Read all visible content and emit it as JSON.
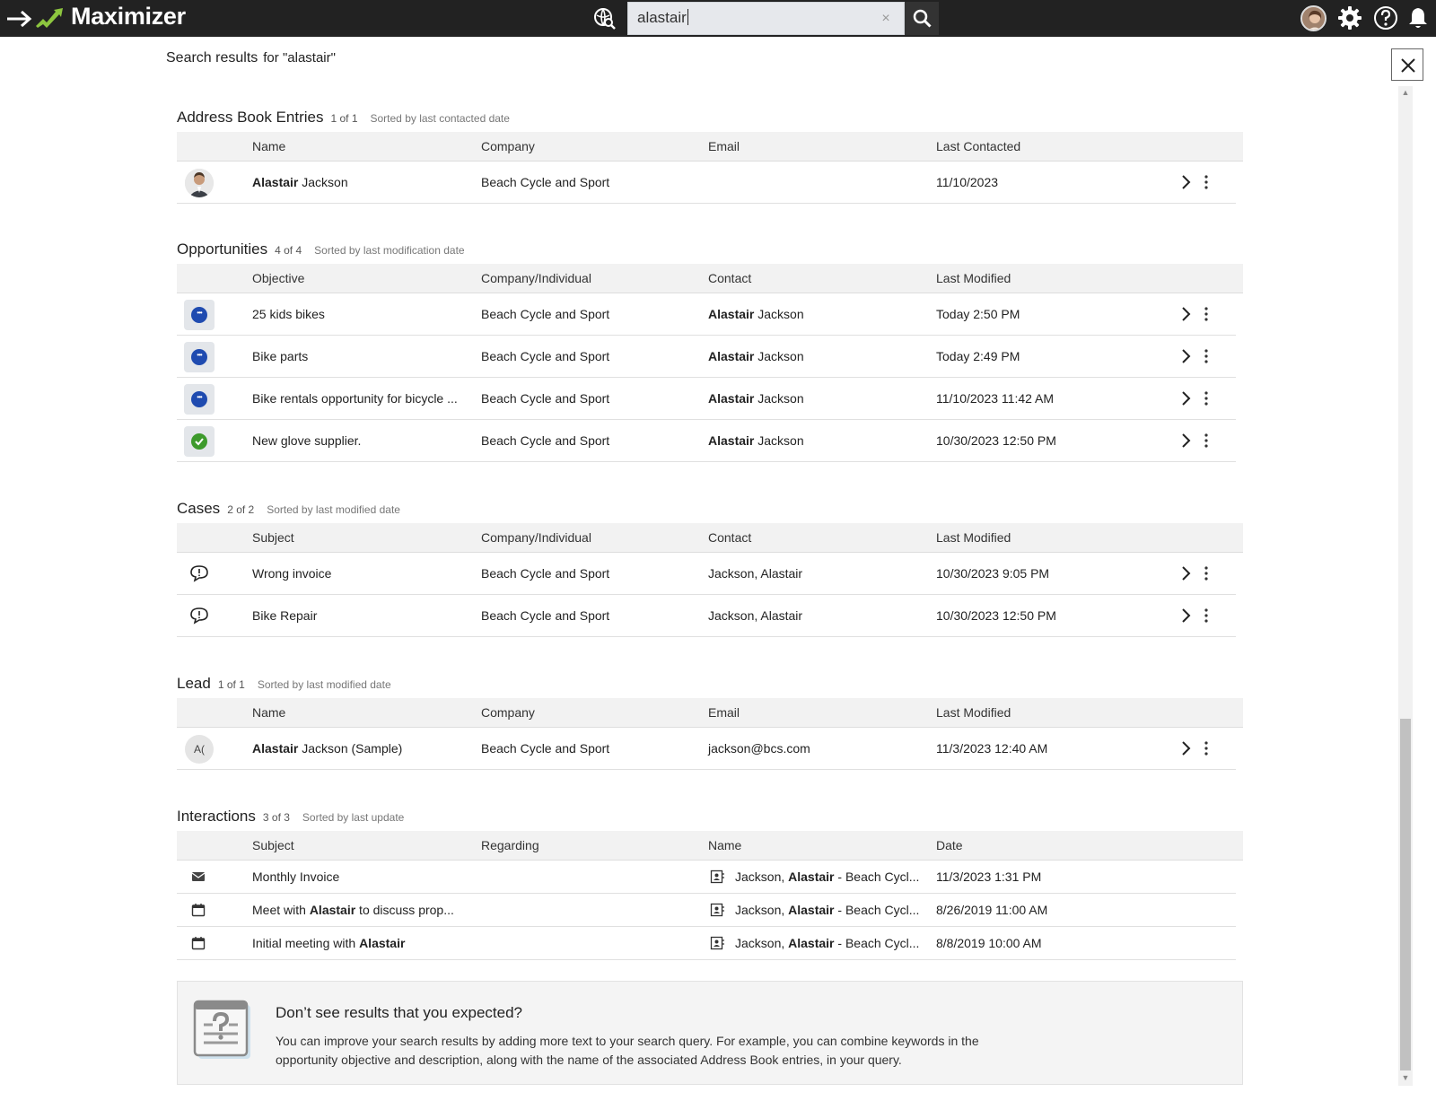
{
  "app": {
    "name": "Maximizer"
  },
  "search": {
    "value": "alastair",
    "clear_icon": "close-icon"
  },
  "header": {
    "title": "Search results",
    "query_label": "for \"alastair\""
  },
  "sections": {
    "address_book": {
      "title": "Address Book Entries",
      "count": "1 of 1",
      "sort": "Sorted by last contacted date",
      "columns": [
        "Name",
        "Company",
        "Email",
        "Last Contacted"
      ],
      "rows": [
        {
          "name_bold": "Alastair",
          "name_rest": " Jackson",
          "company": "Beach Cycle and Sport",
          "email": "",
          "date": "11/10/2023"
        }
      ]
    },
    "opportunities": {
      "title": "Opportunities",
      "count": "4 of 4",
      "sort": "Sorted by last modification date",
      "columns": [
        "Objective",
        "Company/Individual",
        "Contact",
        "Last Modified"
      ],
      "rows": [
        {
          "status": "in-progress",
          "objective": "25 kids bikes",
          "company": "Beach Cycle and Sport",
          "contact_bold": "Alastair",
          "contact_rest": " Jackson",
          "date": "Today 2:50 PM"
        },
        {
          "status": "in-progress",
          "objective": "Bike parts",
          "company": "Beach Cycle and Sport",
          "contact_bold": "Alastair",
          "contact_rest": " Jackson",
          "date": "Today 2:49 PM"
        },
        {
          "status": "in-progress",
          "objective": "Bike rentals opportunity for bicycle ...",
          "company": "Beach Cycle and Sport",
          "contact_bold": "Alastair",
          "contact_rest": " Jackson",
          "date": "11/10/2023 11:42 AM"
        },
        {
          "status": "won",
          "objective": "New glove supplier.",
          "company": "Beach Cycle and Sport",
          "contact_bold": "Alastair",
          "contact_rest": " Jackson",
          "date": "10/30/2023 12:50 PM"
        }
      ]
    },
    "cases": {
      "title": "Cases",
      "count": "2 of 2",
      "sort": "Sorted by last modified date",
      "columns": [
        "Subject",
        "Company/Individual",
        "Contact",
        "Last Modified"
      ],
      "rows": [
        {
          "subject": "Wrong invoice",
          "company": "Beach Cycle and Sport",
          "contact": "Jackson, Alastair",
          "date": "10/30/2023 9:05 PM"
        },
        {
          "subject": "Bike Repair",
          "company": "Beach Cycle and Sport",
          "contact": "Jackson, Alastair",
          "date": "10/30/2023 12:50 PM"
        }
      ]
    },
    "lead": {
      "title": "Lead",
      "count": "1 of 1",
      "sort": "Sorted by last modified date",
      "columns": [
        "Name",
        "Company",
        "Email",
        "Last Modified"
      ],
      "rows": [
        {
          "initials": "A(",
          "name_bold": "Alastair",
          "name_rest": " Jackson (Sample)",
          "company": "Beach Cycle and Sport",
          "email": "jackson@bcs.com",
          "date": "11/3/2023 12:40 AM"
        }
      ]
    },
    "interactions": {
      "title": "Interactions",
      "count": "3 of 3",
      "sort": "Sorted by last update",
      "columns": [
        "Subject",
        "Regarding",
        "Name",
        "Date"
      ],
      "rows": [
        {
          "type": "email",
          "subject_pre": "Monthly Invoice",
          "subject_bold": "",
          "subject_post": "",
          "name_pre": "Jackson, ",
          "name_bold": "Alastair",
          "name_post": " - Beach Cycl...",
          "date": "11/3/2023 1:31 PM"
        },
        {
          "type": "appointment",
          "subject_pre": "Meet with ",
          "subject_bold": "Alastair",
          "subject_post": " to discuss prop...",
          "name_pre": "Jackson, ",
          "name_bold": "Alastair",
          "name_post": " - Beach Cycl...",
          "date": "8/26/2019 11:00 AM"
        },
        {
          "type": "appointment",
          "subject_pre": "Initial meeting with ",
          "subject_bold": "Alastair",
          "subject_post": "",
          "name_pre": "Jackson, ",
          "name_bold": "Alastair",
          "name_post": " - Beach Cycl...",
          "date": "8/8/2019 10:00 AM"
        }
      ]
    }
  },
  "help": {
    "title": "Don’t see results that you expected?",
    "text": "You can improve your search results by adding more text to your search query. For example, you can combine keywords in the opportunity objective and description, along with the name of the associated Address Book entries, in your query."
  },
  "colors": {
    "topbar": "#222222",
    "accent": "#8dc63f",
    "status_in_progress": "#1f4bb0",
    "status_won": "#3d9a2c"
  }
}
